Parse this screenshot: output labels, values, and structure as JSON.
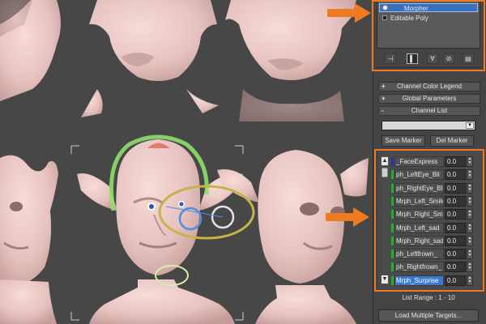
{
  "modifier_stack": {
    "items": [
      {
        "label": "Morpher",
        "selected": true,
        "icon": "lightbulb-icon"
      },
      {
        "label": "Editable Poly",
        "selected": false,
        "icon": "object-square-icon"
      }
    ]
  },
  "stack_toolbar": {
    "buttons": [
      {
        "icon": "pin-stack-icon",
        "glyph": "⊣"
      },
      {
        "icon": "show-end-result-icon",
        "glyph": "▌"
      },
      {
        "icon": "make-unique-icon",
        "glyph": "∀"
      },
      {
        "icon": "remove-modifier-icon",
        "glyph": "⊘"
      },
      {
        "icon": "configure-modifier-sets-icon",
        "glyph": "▤"
      }
    ]
  },
  "rollouts": {
    "channel_color_legend": {
      "sign": "+",
      "label": "Channel Color Legend"
    },
    "global_parameters": {
      "sign": "+",
      "label": "Global Parameters"
    },
    "channel_list": {
      "sign": "-",
      "label": "Channel List"
    }
  },
  "marker_dropdown": {
    "value": ""
  },
  "buttons": {
    "save_marker": "Save Marker",
    "del_marker": "Del Marker",
    "load_multiple_targets": "Load Multiple Targets..."
  },
  "channel_list": {
    "channels": [
      {
        "name": "_FaceExpress",
        "value": "0.0",
        "color": "#2230b8",
        "selected": false
      },
      {
        "name": "ph_LeftEye_Bli",
        "value": "0.0",
        "color": "#1fb31f",
        "selected": false
      },
      {
        "name": "ph_RightEye_Bli",
        "value": "0.0",
        "color": "#1fb31f",
        "selected": false
      },
      {
        "name": "Mrph_Left_Smile",
        "value": "0.0",
        "color": "#1fb31f",
        "selected": false
      },
      {
        "name": "Mrph_Right_Smil",
        "value": "0.0",
        "color": "#1fb31f",
        "selected": false
      },
      {
        "name": "Mrph_Left_sad",
        "value": "0.0",
        "color": "#1fb31f",
        "selected": false
      },
      {
        "name": "Mrph_Right_sad",
        "value": "0.0",
        "color": "#1fb31f",
        "selected": false
      },
      {
        "name": "ph_Leftfrown_",
        "value": "0.0",
        "color": "#1fb31f",
        "selected": false
      },
      {
        "name": "ph_Rightfrown_",
        "value": "0.0",
        "color": "#1fb31f",
        "selected": false
      },
      {
        "name": "Mrph_Surprise",
        "value": "0.0",
        "color": "#1fb31f",
        "selected": true
      }
    ],
    "scroll_up": "▲",
    "scroll_down": "▼",
    "list_range": "List Range :   1 - 10"
  },
  "annotations": {
    "highlight_color": "#f07a22"
  },
  "viewport": {
    "background": "#474747",
    "skin_color": "#e8c7c4"
  }
}
